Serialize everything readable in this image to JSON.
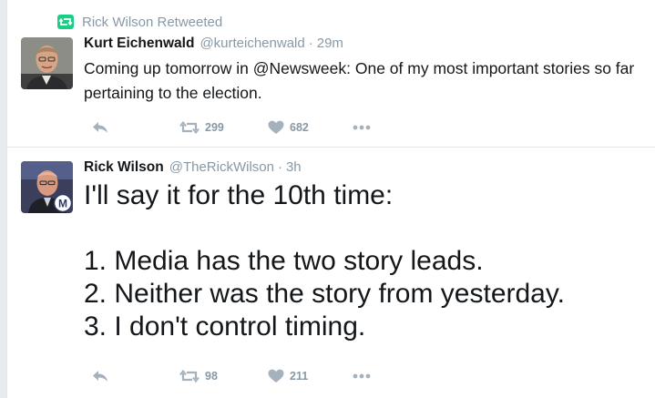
{
  "colors": {
    "retweet_green": "#19cf86",
    "muted": "#8899a6",
    "text": "#14171a",
    "divider": "#e1e8ed"
  },
  "retweet_context": {
    "icon": "retweet-icon",
    "text": "Rick Wilson Retweeted"
  },
  "tweets": [
    {
      "fullname": "Kurt Eichenwald",
      "handle": "@kurteichenwald",
      "separator": "·",
      "time": "29m",
      "text": "Coming up tomorrow in @Newsweek: One of my most important stories so far pertaining to the election.",
      "actions": {
        "reply_icon": "reply-icon",
        "retweet_icon": "retweet-icon",
        "retweet_count": "299",
        "like_icon": "heart-icon",
        "like_count": "682",
        "more_icon": "more-icon"
      }
    },
    {
      "fullname": "Rick Wilson",
      "handle": "@TheRickWilson",
      "separator": "·",
      "time": "3h",
      "text_lines": [
        "I'll say it for the 10th time:",
        "",
        "1. Media has the two story leads.",
        "2. Neither was the story from yesterday.",
        "3. I don't control timing."
      ],
      "avatar_badge": "M",
      "actions": {
        "reply_icon": "reply-icon",
        "retweet_icon": "retweet-icon",
        "retweet_count": "98",
        "like_icon": "heart-icon",
        "like_count": "211",
        "more_icon": "more-icon"
      }
    }
  ]
}
